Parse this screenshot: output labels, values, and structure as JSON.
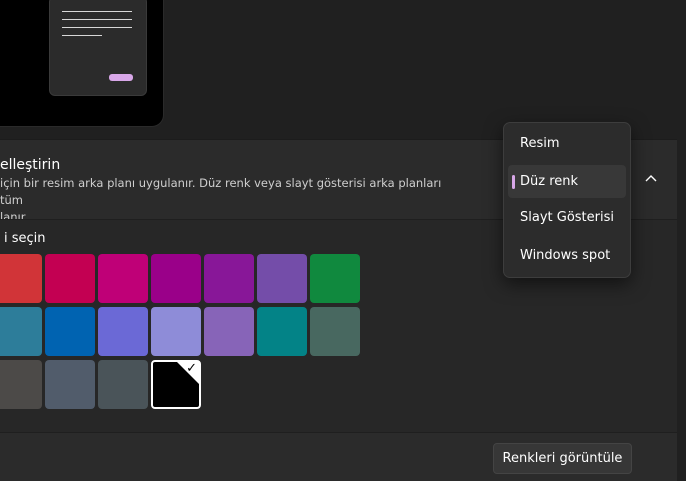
{
  "personalize": {
    "title": "elleştirin",
    "description_line1": "için bir resim arka planı uygulanır. Düz renk veya slayt gösterisi arka planları tüm",
    "description_line2": "lanır."
  },
  "colors": {
    "label": "i seçin",
    "rows": [
      [
        "#d13438",
        "#c30052",
        "#bf0077",
        "#9a0089",
        "#881798",
        "#744da9",
        "#10893e"
      ],
      [
        "#2d7d9a",
        "#0063b1",
        "#6b69d6",
        "#8e8cd8",
        "#8764b8",
        "#038387",
        "#486860"
      ],
      [
        "#4c4a48",
        "#515c6b",
        "#4a5459",
        "#000000"
      ]
    ],
    "selected": "#000000"
  },
  "view_colors_button": "Renkleri görüntüle",
  "dropdown": {
    "options": [
      "Resim",
      "Düz renk",
      "Slayt Gösterisi",
      "Windows spot"
    ],
    "selected": "Düz renk",
    "accent": "#d8a7e8"
  },
  "icons": {
    "collapse": "chevron-up-icon",
    "selected_swatch": "checkmark-icon"
  }
}
